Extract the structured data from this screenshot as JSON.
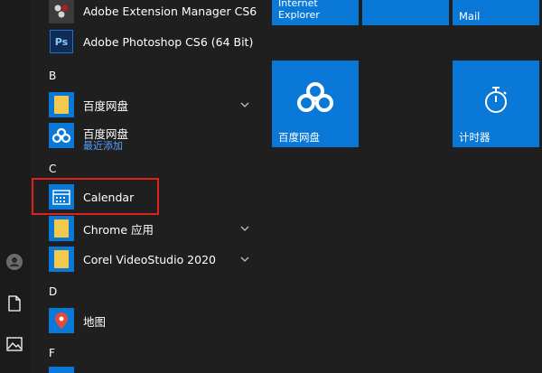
{
  "rail": {
    "icons": [
      "user-icon",
      "document-icon",
      "pictures-icon"
    ]
  },
  "app_list": {
    "adobe_extension_manager": "Adobe Extension Manager CS6",
    "adobe_photoshop": "Adobe Photoshop CS6 (64 Bit)",
    "letter_b": "B",
    "baidu_folder": "百度网盘",
    "baidu_app": "百度网盘",
    "baidu_app_sub": "最近添加",
    "letter_c": "C",
    "calendar": "Calendar",
    "chrome_folder": "Chrome 应用",
    "corel_folder": "Corel VideoStudio 2020",
    "letter_d": "D",
    "maps": "地图",
    "letter_f": "F"
  },
  "tiles": {
    "internet_explorer": "Internet Explorer",
    "mail": "Mail",
    "baidu": "百度网盘",
    "timer": "计时器"
  },
  "colors": {
    "tile_blue": "#0a78d7",
    "folder_yellow": "#f2c94c",
    "highlight_red": "#e0201b",
    "recent_blue": "#5aa0ff"
  }
}
